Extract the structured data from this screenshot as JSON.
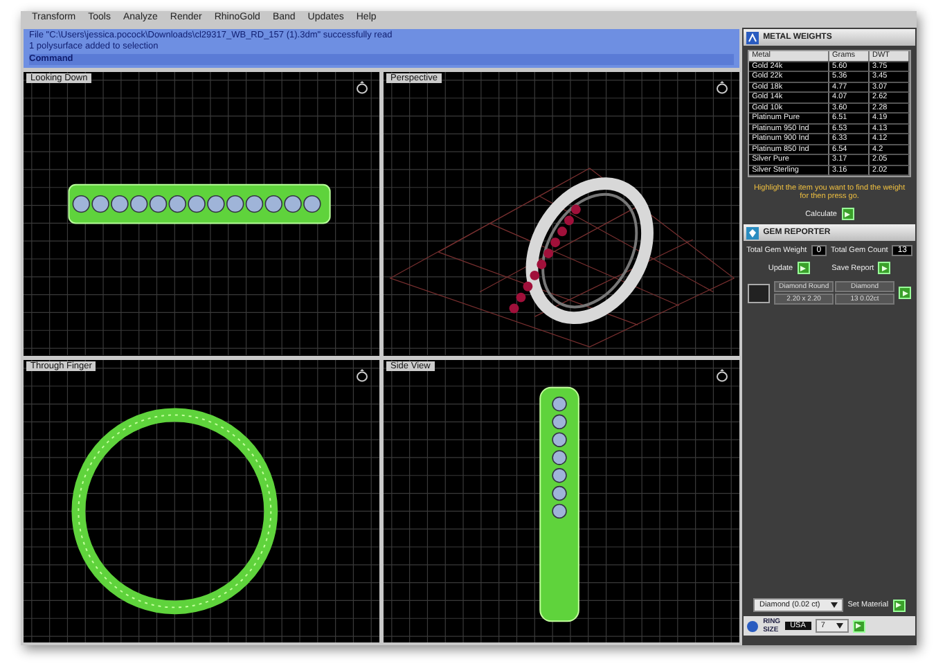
{
  "menu": [
    "Transform",
    "Tools",
    "Analyze",
    "Render",
    "RhinoGold",
    "Band",
    "Updates",
    "Help"
  ],
  "command_history": [
    "File \"C:\\Users\\jessica.pocock\\Downloads\\cl29317_WB_RD_157 (1).3dm\" successfully read",
    "1 polysurface added to selection"
  ],
  "command_prompt": "Command",
  "viewports": [
    {
      "title": "Looking Down",
      "kind": "top"
    },
    {
      "title": "Perspective",
      "kind": "perspective"
    },
    {
      "title": "Through Finger",
      "kind": "front"
    },
    {
      "title": "Side View",
      "kind": "side"
    }
  ],
  "metal_weights": {
    "title": "METAL WEIGHTS",
    "columns": [
      "Metal",
      "Grams",
      "DWT"
    ],
    "rows": [
      [
        "Gold 24k",
        "5.60",
        "3.75"
      ],
      [
        "Gold 22k",
        "5.36",
        "3.45"
      ],
      [
        "Gold 18k",
        "4.77",
        "3.07"
      ],
      [
        "Gold 14k",
        "4.07",
        "2.62"
      ],
      [
        "Gold 10k",
        "3.60",
        "2.28"
      ],
      [
        "Platinum Pure",
        "6.51",
        "4.19"
      ],
      [
        "Platinum 950 Ind",
        "6.53",
        "4.13"
      ],
      [
        "Platinum 900 Ind",
        "6.33",
        "4.12"
      ],
      [
        "Platinum 850 Ind",
        "6.54",
        "4.2"
      ],
      [
        "Silver Pure",
        "3.17",
        "2.05"
      ],
      [
        "Silver Sterling",
        "3.16",
        "2.02"
      ]
    ],
    "hint": "Highlight the item you want to find the weight for then press go.",
    "calculate_label": "Calculate"
  },
  "gem_reporter": {
    "title": "GEM REPORTER",
    "total_weight_label": "Total Gem Weight",
    "total_weight": "0",
    "total_count_label": "Total Gem Count",
    "total_count": "13",
    "update_label": "Update",
    "save_label": "Save Report",
    "gems": [
      {
        "shape": "Diamond Round",
        "size": "2.20 x 2.20",
        "material": "Diamond",
        "count": "13",
        "weight": "0.02ct"
      }
    ]
  },
  "material_select": {
    "value": "Diamond (0.02 ct)"
  },
  "set_material_label": "Set Material",
  "ring_size": {
    "label_top": "RING",
    "label_bottom": "SIZE",
    "standard": "USA",
    "size": "7"
  }
}
